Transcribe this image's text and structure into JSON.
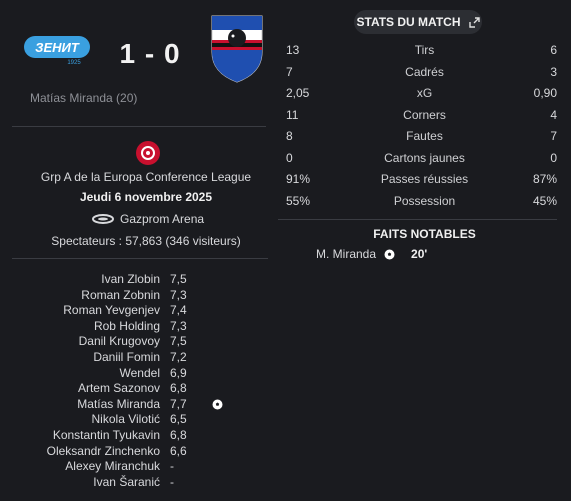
{
  "header": {
    "score": "1 - 0",
    "home_logo_text": "ЗЕНИТ",
    "home_logo_year": "1925",
    "home_scorer": "Matías Miranda (20)"
  },
  "match_info": {
    "competition": "Grp A de la Europa Conference League",
    "date": "Jeudi 6 novembre 2025",
    "venue": "Gazprom Arena",
    "attendance": "Spectateurs : 57,863 (346 visiteurs)"
  },
  "ratings": [
    {
      "name": "Ivan Zlobin",
      "rating": "7,5",
      "event": ""
    },
    {
      "name": "Roman Zobnin",
      "rating": "7,3",
      "event": ""
    },
    {
      "name": "Roman Yevgenjev",
      "rating": "7,4",
      "event": ""
    },
    {
      "name": "Rob Holding",
      "rating": "7,3",
      "event": ""
    },
    {
      "name": "Danil Krugovoy",
      "rating": "7,5",
      "event": ""
    },
    {
      "name": "Daniil Fomin",
      "rating": "7,2",
      "event": ""
    },
    {
      "name": "Wendel",
      "rating": "6,9",
      "event": ""
    },
    {
      "name": "Artem Sazonov",
      "rating": "6,8",
      "event": ""
    },
    {
      "name": "Matías Miranda",
      "rating": "7,7",
      "event": "goal"
    },
    {
      "name": "Nikola Vilotić",
      "rating": "6,5",
      "event": ""
    },
    {
      "name": "Konstantin Tyukavin",
      "rating": "6,8",
      "event": ""
    },
    {
      "name": "Oleksandr Zinchenko",
      "rating": "6,6",
      "event": ""
    },
    {
      "name": "Alexey Miranchuk",
      "rating": "-",
      "event": ""
    },
    {
      "name": "Ivan Šaranić",
      "rating": "-",
      "event": ""
    }
  ],
  "stats": {
    "title": "STATS DU MATCH",
    "rows": [
      {
        "home": "13",
        "label": "Tirs",
        "away": "6"
      },
      {
        "home": "7",
        "label": "Cadrés",
        "away": "3"
      },
      {
        "home": "2,05",
        "label": "xG",
        "away": "0,90"
      },
      {
        "home": "11",
        "label": "Corners",
        "away": "4"
      },
      {
        "home": "8",
        "label": "Fautes",
        "away": "7"
      },
      {
        "home": "0",
        "label": "Cartons jaunes",
        "away": "0"
      },
      {
        "home": "91%",
        "label": "Passes réussies",
        "away": "87%"
      },
      {
        "home": "55%",
        "label": "Possession",
        "away": "45%"
      }
    ]
  },
  "notable": {
    "title": "FAITS NOTABLES",
    "events": [
      {
        "player": "M. Miranda",
        "icon": "football-icon",
        "minute": "20'"
      }
    ]
  },
  "colors": {
    "background": "#1a1b1f",
    "zenit_blue": "#3aa0e0",
    "samp_blue": "#1f4fb0",
    "uefa_red": "#c8102e"
  }
}
